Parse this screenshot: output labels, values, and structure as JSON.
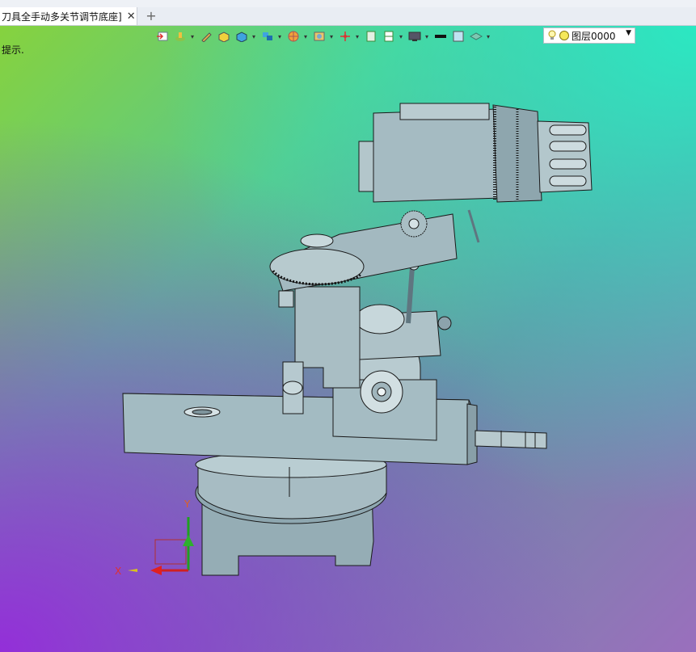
{
  "tabs": [
    {
      "label": "刀具全手动多关节调节底座]",
      "close": "✕"
    }
  ],
  "new_tab": "+",
  "toolbar": {
    "icons": [
      "import-icon",
      "paint-icon",
      "pen-icon",
      "solid-yellow-icon",
      "box-blue-icon",
      "views-icon",
      "pie-icon",
      "view-circle-icon",
      "axis-icon",
      "doc-icon",
      "split-icon",
      "display-icon",
      "line-color",
      "fill-box-icon",
      "layer-stack-icon"
    ],
    "layer_label": "图层0000"
  },
  "hint": "提示.",
  "triad": {
    "x": "X",
    "y": "Y"
  },
  "colors": {
    "model_fill": "#9eb5bd",
    "model_edge": "#1a1a1a"
  }
}
